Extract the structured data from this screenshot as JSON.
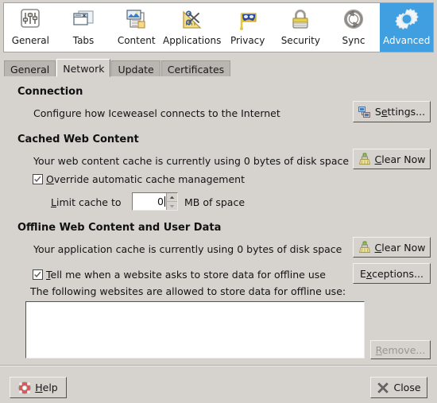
{
  "window": {
    "title": "Iceweasel Preferences",
    "background": "#d6d2ce",
    "accent": "#3f9fe0"
  },
  "toolbar": {
    "items": [
      {
        "label": "General",
        "icon": "sliders-icon",
        "selected": false
      },
      {
        "label": "Tabs",
        "icon": "tabs-icon",
        "selected": false
      },
      {
        "label": "Content",
        "icon": "content-page-icon",
        "selected": false
      },
      {
        "label": "Applications",
        "icon": "scissors-ruler-icon",
        "selected": false
      },
      {
        "label": "Privacy",
        "icon": "mask-icon",
        "selected": false
      },
      {
        "label": "Security",
        "icon": "padlock-icon",
        "selected": false
      },
      {
        "label": "Sync",
        "icon": "sync-arrows-icon",
        "selected": false
      },
      {
        "label": "Advanced",
        "icon": "gear-icon",
        "selected": true
      }
    ]
  },
  "subtabs": {
    "items": [
      {
        "label": "General",
        "active": false
      },
      {
        "label": "Network",
        "active": true
      },
      {
        "label": "Update",
        "active": false
      },
      {
        "label": "Certificates",
        "active": false
      }
    ]
  },
  "sections": {
    "connection": {
      "heading": "Connection",
      "description": "Configure how Iceweasel connects to the Internet",
      "settings_button": {
        "pre": "S",
        "mnemonic": "e",
        "post": "ttings...",
        "icon": "network-settings-icon"
      }
    },
    "cached": {
      "heading": "Cached Web Content",
      "usage_text": "Your web content cache is currently using 0 bytes of disk space",
      "clear_button": {
        "pre": "",
        "mnemonic": "C",
        "post": "lear Now",
        "icon": "broom-icon"
      },
      "override_checkbox": {
        "checked": true,
        "pre": "",
        "mnemonic": "O",
        "post": "verride automatic cache management"
      },
      "limit_label": {
        "pre": "",
        "mnemonic": "L",
        "post": "imit cache to"
      },
      "limit_value": "0",
      "limit_suffix": "MB of space"
    },
    "offline": {
      "heading": "Offline Web Content and User Data",
      "usage_text": "Your application cache is currently using 0 bytes of disk space",
      "clear_button": {
        "pre": "",
        "mnemonic": "C",
        "post": "lear Now",
        "icon": "broom-icon"
      },
      "tellme_checkbox": {
        "checked": true,
        "pre": "",
        "mnemonic": "T",
        "post": "ell me when a website asks to store data for offline use"
      },
      "exceptions_button": {
        "pre": "E",
        "mnemonic": "x",
        "post": "ceptions..."
      },
      "list_label": "The following websites are allowed to store data for offline use:",
      "list_items": [],
      "remove_button": {
        "pre": "",
        "mnemonic": "R",
        "post": "emove...",
        "disabled": true
      }
    }
  },
  "footer": {
    "help_button": {
      "pre": "",
      "mnemonic": "H",
      "post": "elp",
      "icon": "lifebuoy-icon"
    },
    "close_button": {
      "pre": "",
      "mnemonic": "",
      "post": "Close",
      "icon": "close-x-icon"
    }
  }
}
